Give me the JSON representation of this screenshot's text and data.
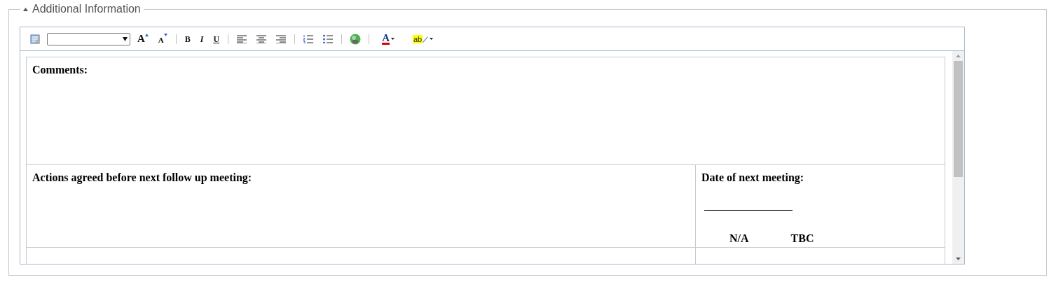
{
  "section": {
    "title": "Additional Information",
    "expanded": true
  },
  "toolbar": [
    {
      "kind": "edit"
    },
    {
      "kind": "font-size"
    },
    {
      "kind": "grow",
      "glyph": "A"
    },
    {
      "kind": "shrink",
      "glyph": "A"
    },
    {
      "kind": "sep"
    },
    {
      "kind": "bold",
      "glyph": "B"
    },
    {
      "kind": "italic",
      "glyph": "I"
    },
    {
      "kind": "underline",
      "glyph": "U"
    },
    {
      "kind": "sep"
    },
    {
      "kind": "left"
    },
    {
      "kind": "center"
    },
    {
      "kind": "right"
    },
    {
      "kind": "sep"
    },
    {
      "kind": "ordered"
    },
    {
      "kind": "bullets"
    },
    {
      "kind": "sep"
    },
    {
      "kind": "link"
    },
    {
      "kind": "sep"
    },
    {
      "kind": "color",
      "glyph": "A"
    },
    {
      "kind": "highlight",
      "glyph": "ab"
    }
  ],
  "table": {
    "header_row": {
      "heading": "Comments:"
    },
    "rows": [
      {
        "cells": [
          {
            "heading": "Actions agreed before next follow up meeting:"
          },
          {
            "heading": "Date of next meeting:",
            "fill_line": true,
            "options": [
              "N/A",
              "TBC"
            ]
          }
        ]
      },
      {
        "cells": [
          {},
          {}
        ]
      }
    ]
  }
}
